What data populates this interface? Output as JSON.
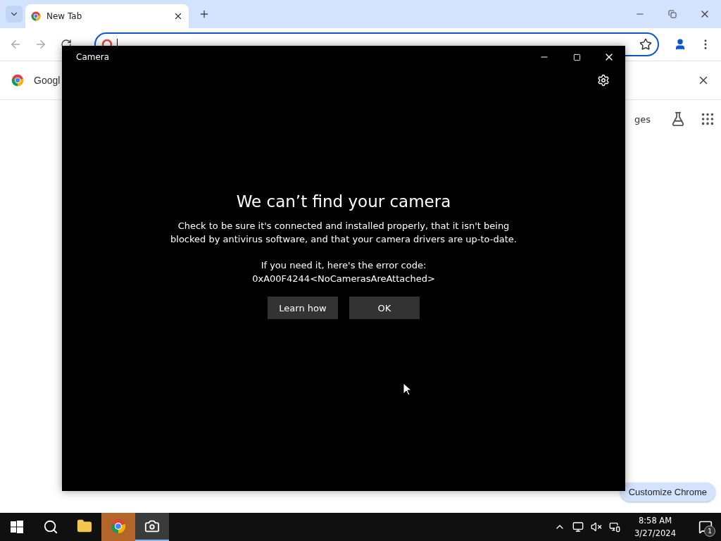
{
  "browser": {
    "tabs": [
      {
        "label": "New Tab",
        "selected": true
      }
    ],
    "info_bar": {
      "text": "Googl"
    },
    "page": {
      "link_text": "ges",
      "customize_button": "Customize Chrome"
    }
  },
  "camera_window": {
    "title": "Camera",
    "heading": "We can’t find your camera",
    "message": "Check to be sure it's connected and installed properly, that it isn't being blocked by antivirus software, and that your camera drivers are up-to-date.",
    "error_intro": "If you need it, here's the error code:",
    "error_code": "0xA00F4244<NoCamerasAreAttached>",
    "buttons": [
      {
        "label": "Learn how"
      },
      {
        "label": "OK"
      }
    ]
  },
  "taskbar": {
    "apps": [
      {
        "kind": "files",
        "selected": false,
        "flashing": false
      },
      {
        "kind": "browser",
        "selected": false,
        "flashing": true
      },
      {
        "kind": "camera",
        "selected": true,
        "flashing": false
      }
    ],
    "clock_time": "8:58 AM",
    "clock_date": "3/27/2024",
    "notification_count": "1"
  }
}
